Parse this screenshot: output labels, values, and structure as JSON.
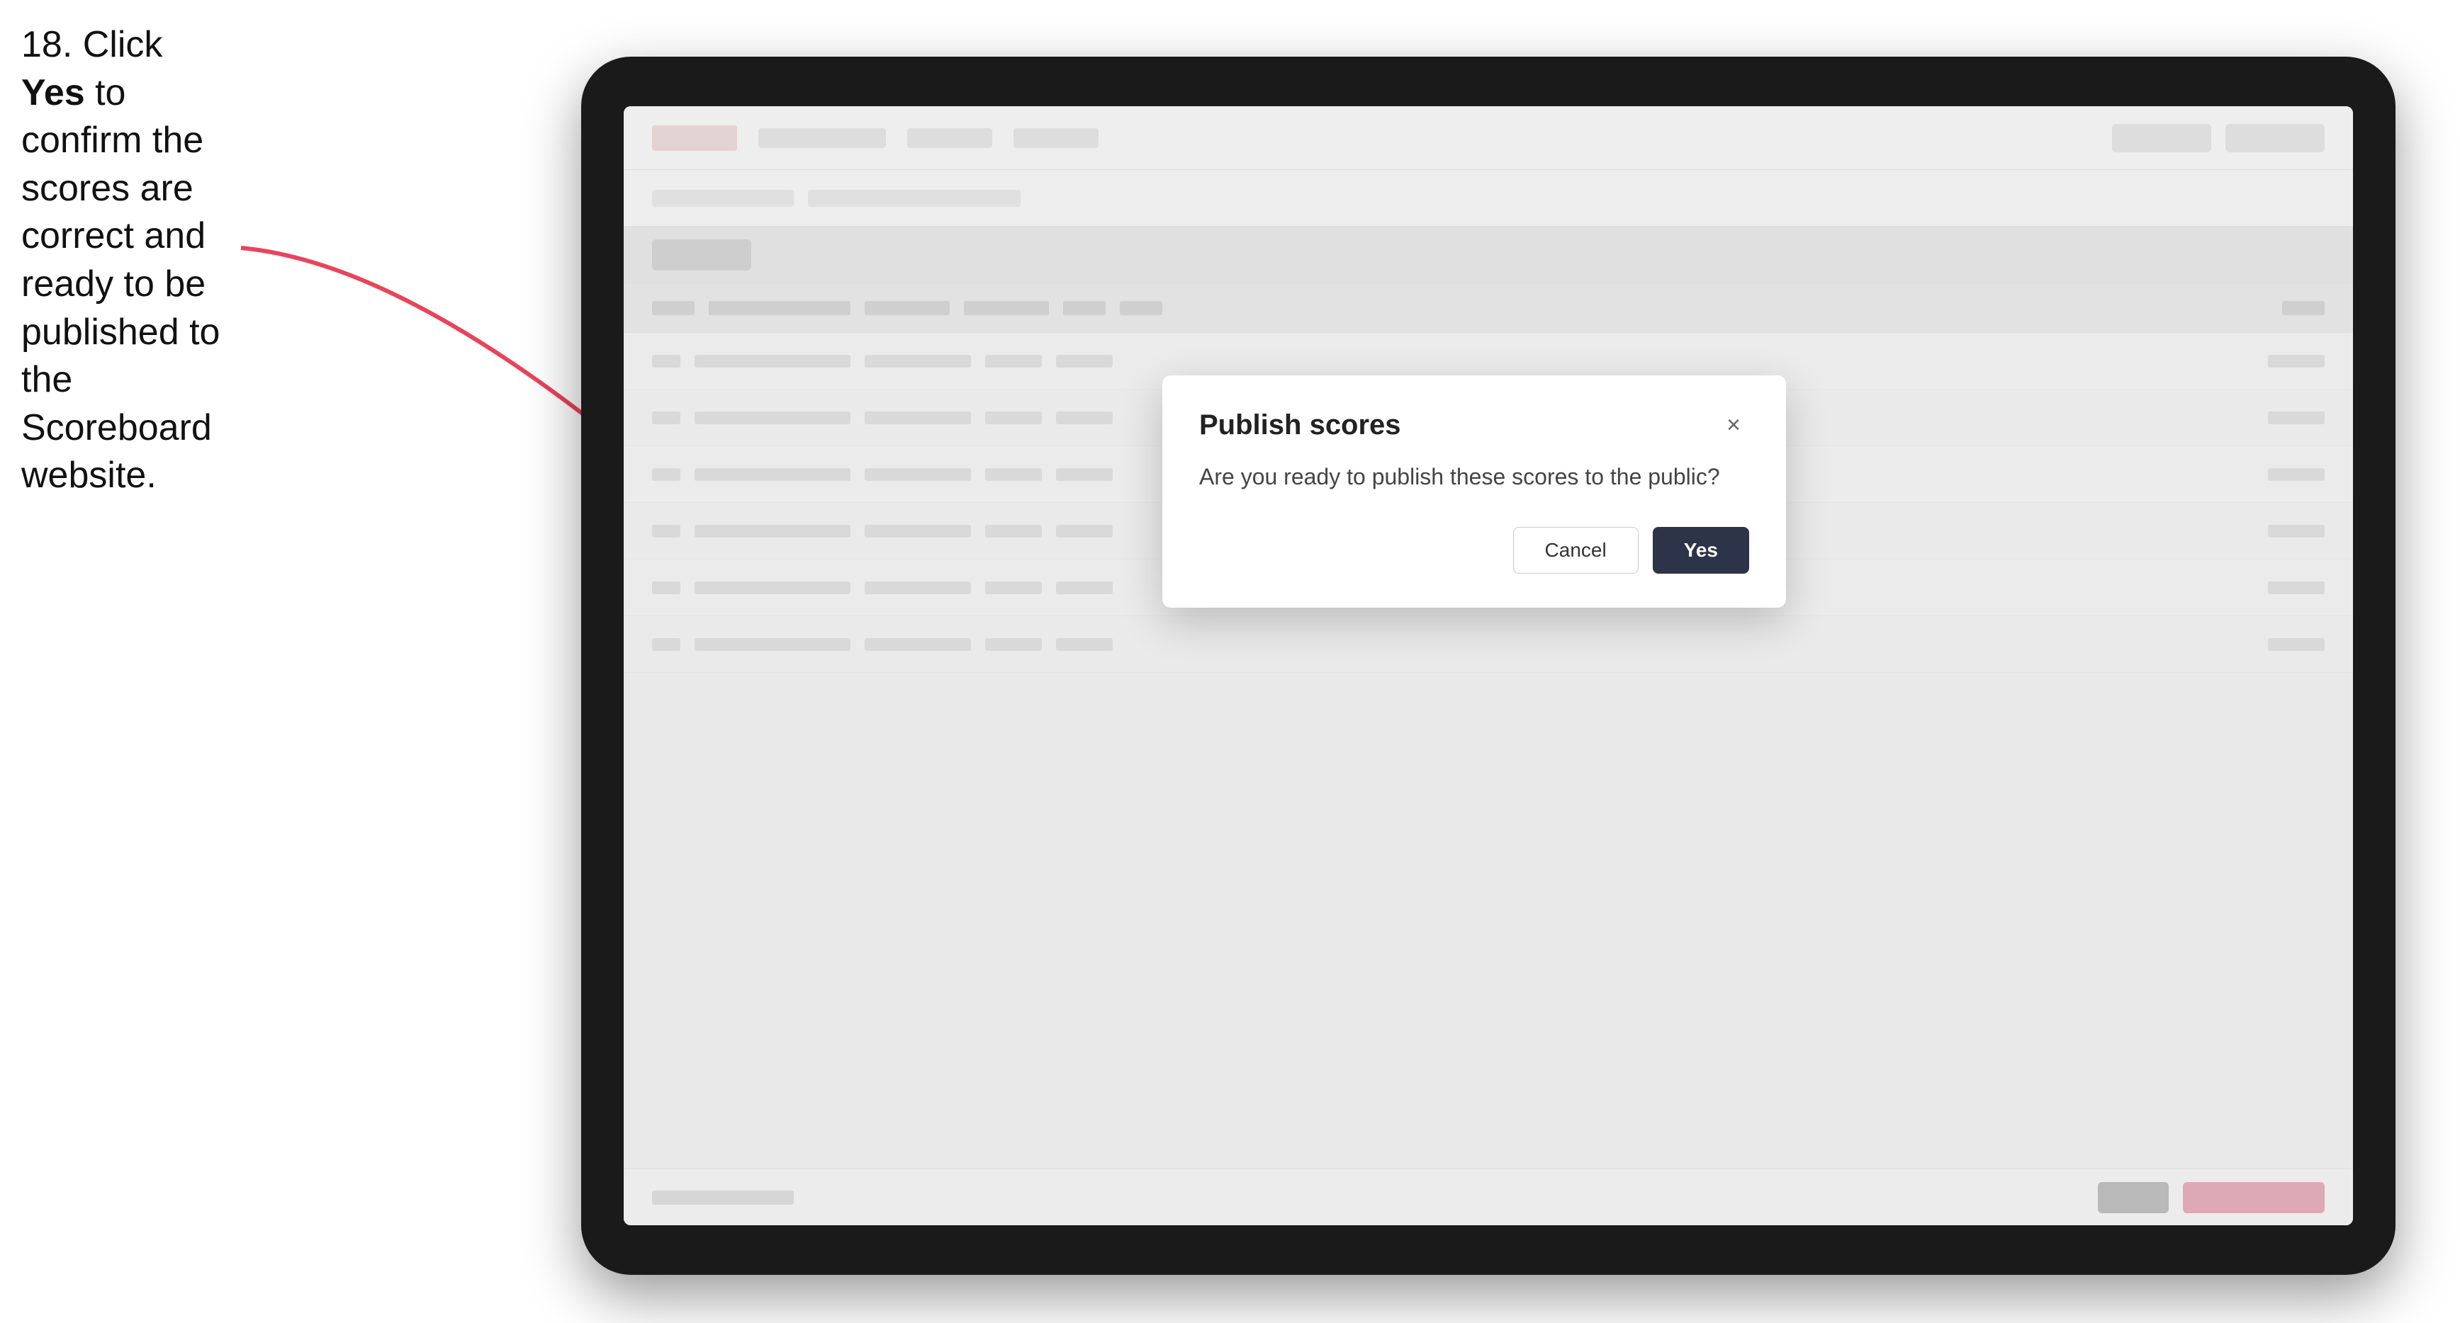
{
  "instruction": {
    "step_number": "18.",
    "text_parts": [
      "Click ",
      "Yes",
      " to confirm the scores are correct and ready to be published to the Scoreboard website."
    ]
  },
  "modal": {
    "title": "Publish scores",
    "body_text": "Are you ready to publish these scores to the public?",
    "cancel_label": "Cancel",
    "yes_label": "Yes",
    "close_icon": "×"
  },
  "colors": {
    "yes_button_bg": "#2d3348",
    "cancel_button_border": "#ccc",
    "arrow_color": "#e8445a",
    "modal_shadow": "rgba(0,0,0,0.2)"
  }
}
